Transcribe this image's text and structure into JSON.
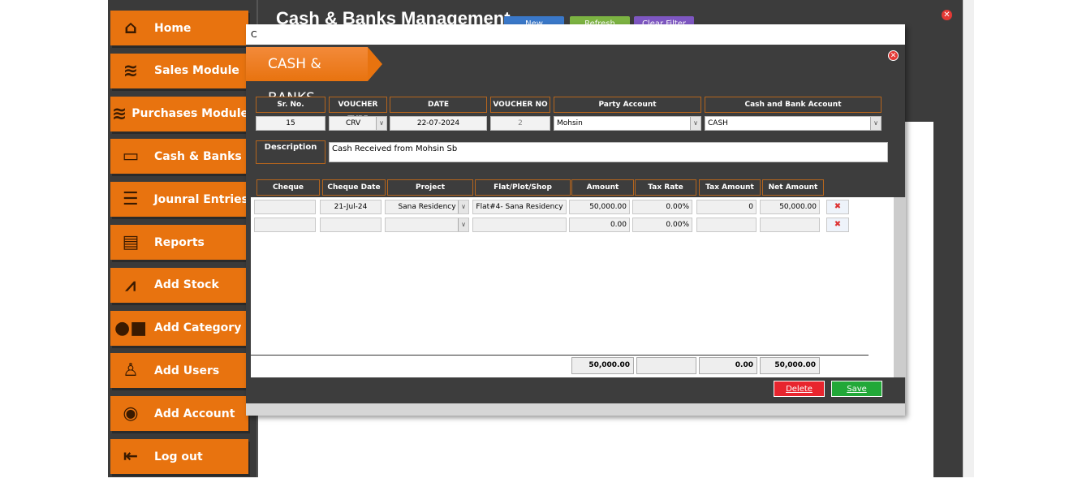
{
  "app": {
    "title": "Cash & Banks Management",
    "toolbar": [
      "New",
      "Refresh",
      "Clear Filter"
    ],
    "close_icon": "close-icon"
  },
  "sidebar": {
    "items": [
      {
        "label": "Home",
        "icon": "house-icon"
      },
      {
        "label": "Sales Module",
        "icon": "coins-icon"
      },
      {
        "label": "Purchases Module",
        "icon": "coins-icon"
      },
      {
        "label": "Cash & Banks",
        "icon": "money-icon"
      },
      {
        "label": "Jounral Entries",
        "icon": "list-icon"
      },
      {
        "label": "Reports",
        "icon": "report-icon"
      },
      {
        "label": "Add Stock",
        "icon": "chart-icon"
      },
      {
        "label": "Add Category",
        "icon": "shapes-icon"
      },
      {
        "label": "Add Users",
        "icon": "user-icon"
      },
      {
        "label": "Add Account",
        "icon": "account-icon"
      },
      {
        "label": "Log out",
        "icon": "logout-icon"
      }
    ]
  },
  "dialog": {
    "title": "C",
    "banner": "CASH & BANKS",
    "header": {
      "labels": [
        "Sr. No.",
        "VOUCHER TYPE",
        "DATE",
        "VOUCHER NO",
        "Party Account",
        "Cash and Bank Account"
      ],
      "values": [
        "15",
        "CRV",
        "22-07-2024",
        "2",
        "Mohsin",
        "CASH"
      ]
    },
    "description": {
      "label": "Description",
      "value": "Cash Received from Mohsin Sb"
    },
    "grid": {
      "columns": [
        "Cheque Number",
        "Cheque Date",
        "Project",
        "Flat/Plot/Shop",
        "Amount",
        "Tax Rate",
        "Tax Amount",
        "Net Amount"
      ],
      "rows": [
        [
          "",
          "21-Jul-24",
          "Sana Residency",
          "Flat#4- Sana Residency",
          "50,000.00",
          "0.00%",
          "0",
          "50,000.00"
        ],
        [
          "",
          "",
          "",
          "",
          "0.00",
          "0.00%",
          "",
          ""
        ]
      ]
    },
    "totals": {
      "amount": "50,000.00",
      "tax_rate": "",
      "tax_amount": "0.00",
      "net_amount": "50,000.00"
    },
    "buttons": {
      "delete": "Delete",
      "save": "Save"
    },
    "colors": {
      "accent": "#e8730f",
      "delete": "#e8252e",
      "save": "#22a838"
    }
  }
}
